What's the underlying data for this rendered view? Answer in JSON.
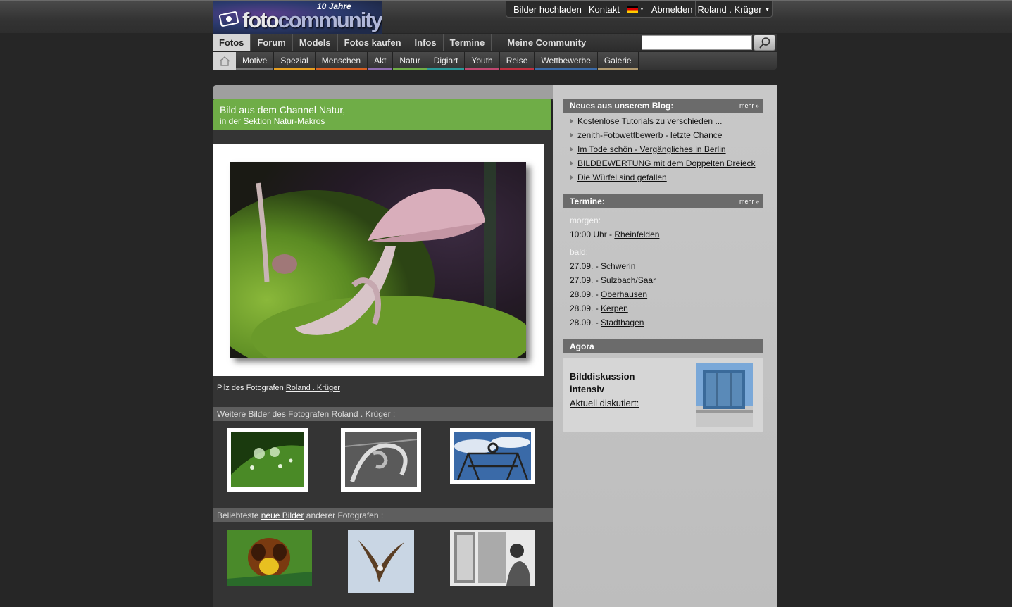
{
  "header": {
    "logo_top": "10 Jahre",
    "logo_word_a": "foto",
    "logo_word_b": "community",
    "upload": "Bilder hochladen",
    "contact": "Kontakt",
    "language_flag": "de-flag-icon",
    "logout": "Abmelden",
    "user": "Roland . Krüger"
  },
  "mainnav": {
    "items": [
      "Fotos",
      "Forum",
      "Models",
      "Fotos kaufen",
      "Infos",
      "Termine"
    ],
    "community": "Meine Community",
    "search_value": ""
  },
  "subnav": {
    "items": [
      "Motive",
      "Spezial",
      "Menschen",
      "Akt",
      "Natur",
      "Digiart",
      "Youth",
      "Reise",
      "Wettbewerbe",
      "Galerie"
    ],
    "colors": [
      "#777777",
      "#e8a020",
      "#d86020",
      "#8e6cb0",
      "#6fad47",
      "#2a9a9a",
      "#c04870",
      "#c03040",
      "#3a6aa8",
      "#b09a70"
    ]
  },
  "channel": {
    "title": "Bild aus dem Channel Natur,",
    "section_prefix": "in der Sektion",
    "section_link": "Natur-Makros"
  },
  "photo": {
    "caption_prefix": "Pilz des Fotografen",
    "caption_link": "Roland . Krüger"
  },
  "more_photos": {
    "title": "Weitere Bilder des Fotografen Roland . Krüger :"
  },
  "popular": {
    "prefix": "Beliebteste",
    "link": "neue Bilder",
    "suffix": "anderer Fotografen :"
  },
  "blog": {
    "title": "Neues aus unserem Blog:",
    "more": "mehr",
    "items": [
      "Kostenlose Tutorials zu verschieden ...",
      "zenith-Fotowettbewerb - letzte Chance",
      "Im Tode schön - Vergängliches in Berlin",
      "BILDBEWERTUNG mit dem Doppelten Dreieck",
      "Die Würfel sind gefallen"
    ]
  },
  "termine": {
    "title": "Termine:",
    "more": "mehr",
    "tomorrow_label": "morgen:",
    "tomorrow": [
      {
        "time": "10:00 Uhr -",
        "place": "Rheinfelden"
      }
    ],
    "soon_label": "bald:",
    "soon": [
      {
        "date": "27.09. -",
        "place": "Schwerin"
      },
      {
        "date": "27.09. -",
        "place": "Sulzbach/Saar"
      },
      {
        "date": "28.09. -",
        "place": "Oberhausen"
      },
      {
        "date": "28.09. -",
        "place": "Kerpen"
      },
      {
        "date": "28.09. -",
        "place": "Stadthagen"
      }
    ]
  },
  "agora": {
    "title": "Agora",
    "card_title": "Bilddiskussion intensiv",
    "card_link": "Aktuell diskutiert:"
  }
}
